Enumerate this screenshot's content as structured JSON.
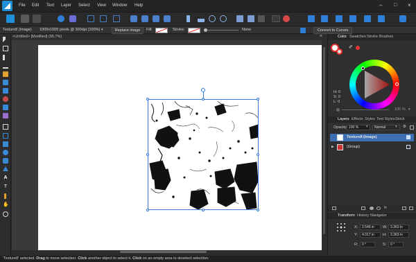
{
  "menu": [
    "File",
    "Edit",
    "Text",
    "Layer",
    "Select",
    "View",
    "Window",
    "Help"
  ],
  "context_bar": {
    "layer_name": "Texture8 (Image)",
    "image_info": "1009x1009 pixels @ 300dpi (100%)",
    "replace_button": "Replace image",
    "fill_label": "Fill:",
    "stroke_label": "Stroke:",
    "stroke_value": "None",
    "convert_button": "Convert to Curves"
  },
  "document_tab": "<Untitled> [Modified] (95.7%)",
  "color_panel": {
    "tabs": [
      "Color",
      "Swatches",
      "Stroke",
      "Brushes"
    ],
    "h": "H: 0",
    "s": "S: 0",
    "l": "L: 0",
    "opacity": "100 %"
  },
  "layers_panel": {
    "tabs": [
      "Layers",
      "Effects",
      "Styles",
      "Text Styles",
      "Stock"
    ],
    "opacity_label": "Opacity:",
    "opacity_value": "100 %",
    "blend_mode": "Normal",
    "rows": [
      {
        "name": "Texture8 (Image)",
        "selected": true
      },
      {
        "name": "(Group)",
        "selected": false
      }
    ]
  },
  "transform_panel": {
    "tabs": [
      "Transform",
      "History",
      "Navigator"
    ],
    "x_label": "X:",
    "x": "2.546 in",
    "y_label": "Y:",
    "y": "4.017 in",
    "w_label": "W:",
    "w": "3.363 in",
    "h_label": "H:",
    "h": "3.363 in",
    "r_label": "R:",
    "r": "0 °",
    "s_label": "S:",
    "s": "0 °"
  },
  "status": {
    "selected_name": "'Texture8'",
    "selected_text": " selected. ",
    "drag": "Drag",
    "drag_text": " to move selection. ",
    "click1": "Click",
    "click1_text": " another object to select it. ",
    "click2": "Click",
    "click2_text": " on an empty area to deselect selection."
  },
  "colors": {
    "accent": "#1e8fd8",
    "selection": "#3b7ad9",
    "layer_selected": "#3e6fb3"
  }
}
